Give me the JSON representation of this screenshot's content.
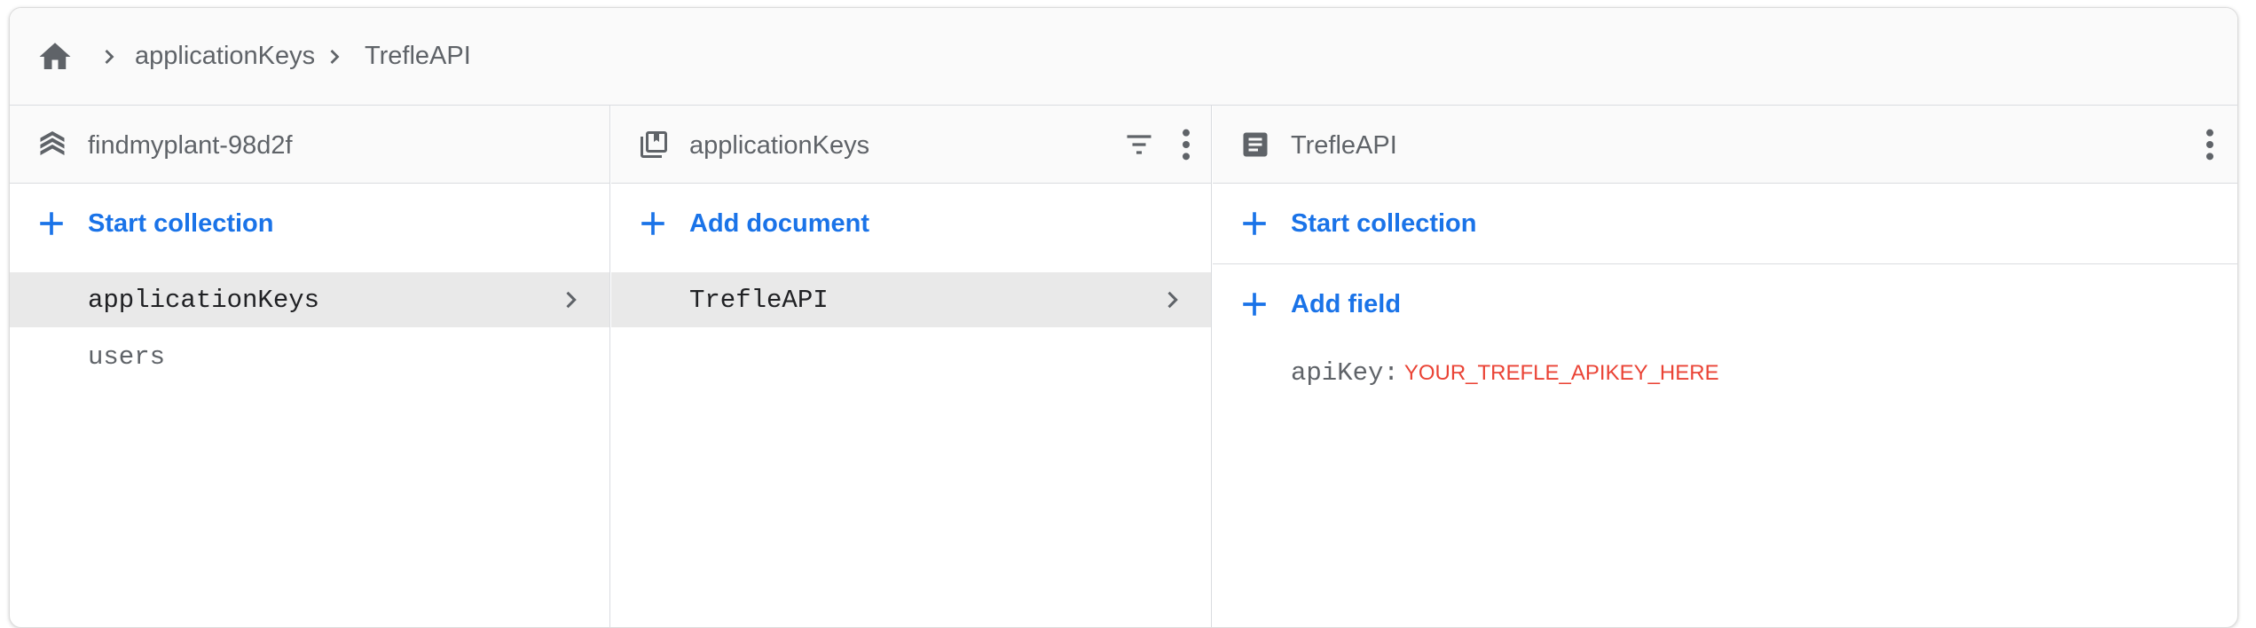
{
  "breadcrumb": {
    "home_icon": "home-icon",
    "items": [
      "applicationKeys",
      "TrefleAPI"
    ]
  },
  "columns": {
    "project": {
      "icon": "firestore-project-icon",
      "title": "findmyplant-98d2f",
      "action_label": "Start collection",
      "items": [
        {
          "label": "applicationKeys",
          "selected": true
        },
        {
          "label": "users",
          "selected": false
        }
      ]
    },
    "collection": {
      "icon": "collection-icon",
      "title": "applicationKeys",
      "action_label": "Add document",
      "items": [
        {
          "label": "TrefleAPI",
          "selected": true
        }
      ]
    },
    "document": {
      "icon": "document-icon",
      "title": "TrefleAPI",
      "start_collection_label": "Start collection",
      "add_field_label": "Add field",
      "fields": [
        {
          "key": "apiKey",
          "separator": ":",
          "value": "YOUR_TREFLE_APIKEY_HERE"
        }
      ]
    }
  },
  "colors": {
    "accent": "#1a73e8",
    "string_value": "#ea4335",
    "selected_row": "#e9e9e9"
  }
}
